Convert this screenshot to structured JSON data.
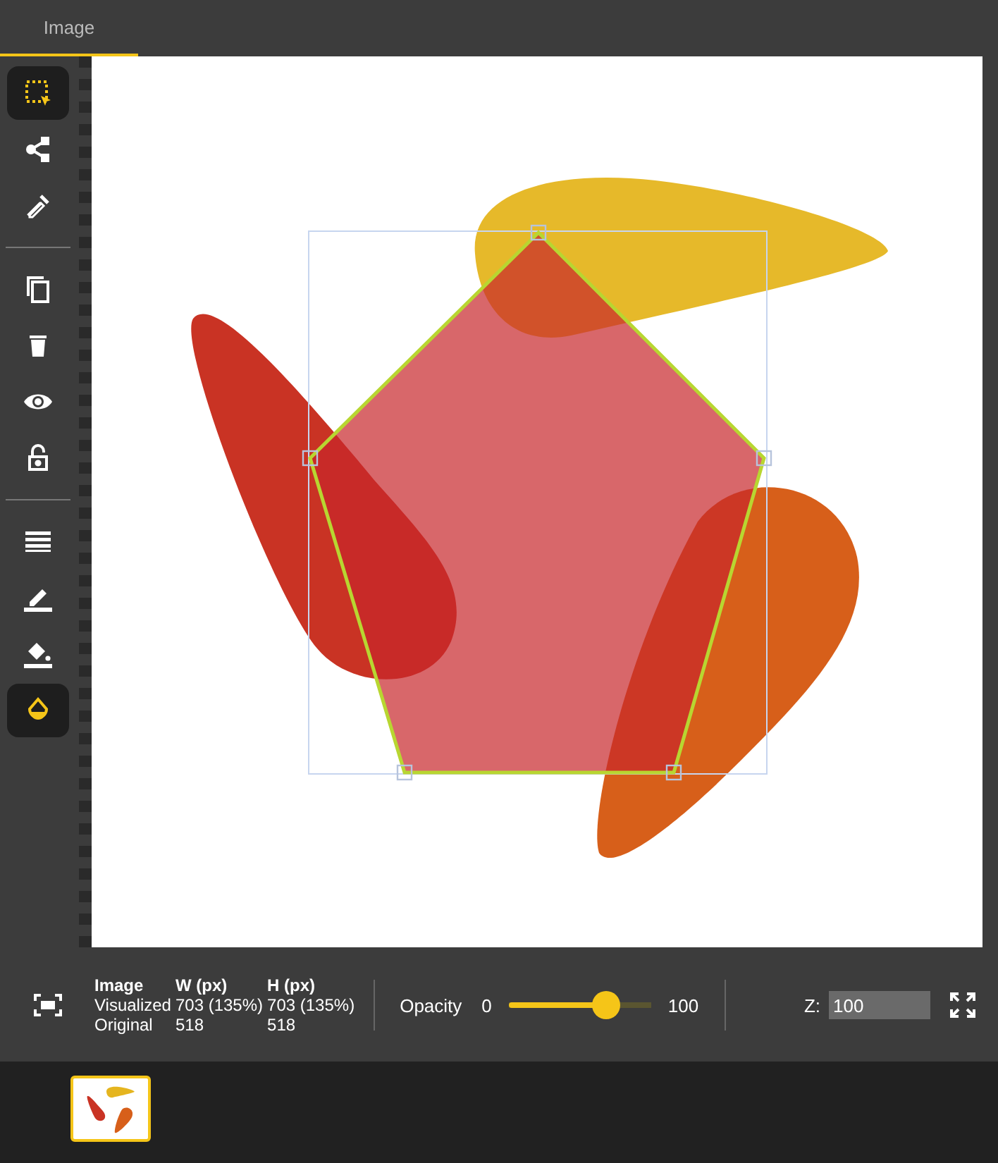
{
  "tabs": [
    {
      "label": "Image",
      "selected": true
    }
  ],
  "toolbar": {
    "groups": [
      [
        {
          "selected": true
        },
        {
          "selected": false
        },
        {
          "selected": false
        }
      ],
      [
        {
          "selected": false
        },
        {
          "selected": false
        },
        {
          "selected": false
        },
        {
          "selected": false
        }
      ],
      [
        {
          "selected": false
        },
        {
          "selected": false
        },
        {
          "selected": false
        },
        {
          "selected": true
        }
      ]
    ]
  },
  "info": {
    "headers": [
      "Image",
      "W (px)",
      "H (px)"
    ],
    "rows": [
      [
        "Visualized",
        "703 (135%)",
        "703 (135%)"
      ],
      [
        "Original",
        "518",
        "518"
      ]
    ]
  },
  "opacity": {
    "label": "Opacity",
    "min": "0",
    "max": "100",
    "level": 0.68
  },
  "z": {
    "label": "Z:",
    "value": "100"
  },
  "thumbnails": [
    {
      "selected": true
    }
  ]
}
